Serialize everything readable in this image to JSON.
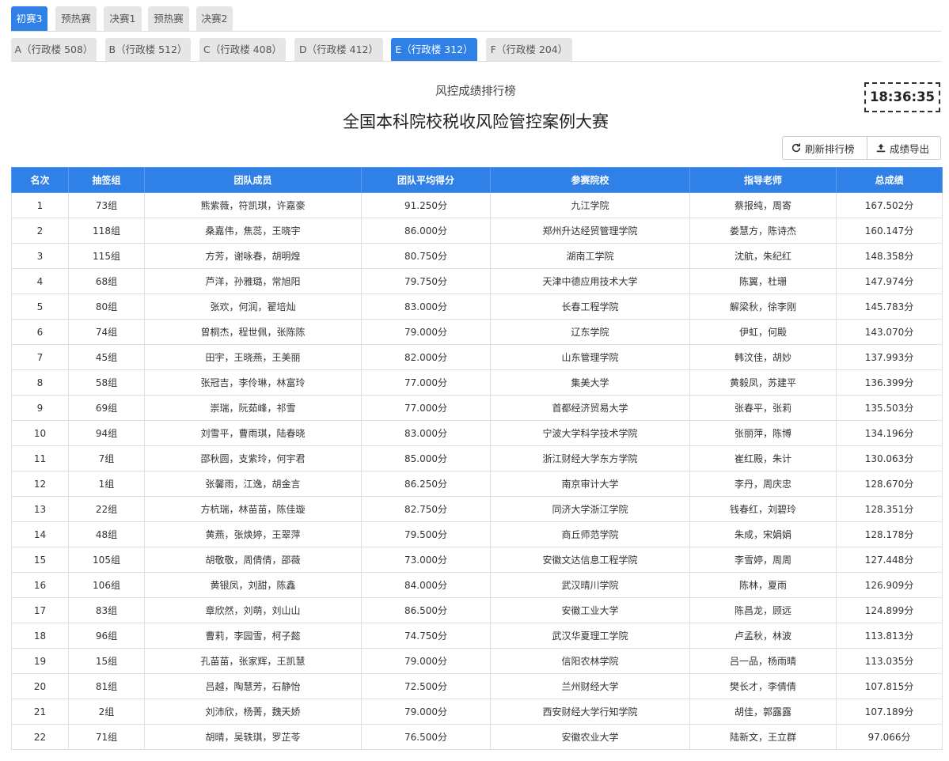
{
  "round_tabs": [
    "初赛3",
    "预热赛",
    "决赛1",
    "预热赛",
    "决赛2"
  ],
  "room_tabs": [
    "A（行政楼 508）",
    "B（行政楼 512）",
    "C（行政楼 408）",
    "D（行政楼 412）",
    "E（行政楼 312）",
    "F（行政楼 204）"
  ],
  "active_round": "初赛3",
  "active_room": "E（行政楼 312）",
  "subtitle": "风控成绩排行榜",
  "title": "全国本科院校税收风险管控案例大赛",
  "clock": "18:36:35",
  "buttons": {
    "refresh": "刷新排行榜",
    "export": "成绩导出"
  },
  "accent_color": "#2f80e7",
  "table": {
    "headers": [
      "名次",
      "抽签组",
      "团队成员",
      "团队平均得分",
      "参赛院校",
      "指导老师",
      "总成绩"
    ],
    "rows": [
      [
        "1",
        "73组",
        "熊紫薇，符凯琪，许嘉豪",
        "91.250分",
        "九江学院",
        "蔡报纯，周寄",
        "167.502分"
      ],
      [
        "2",
        "118组",
        "桑嘉伟，焦蕊，王晓宇",
        "86.000分",
        "郑州升达经贸管理学院",
        "娄慧方，陈诗杰",
        "160.147分"
      ],
      [
        "3",
        "115组",
        "方芳，谢咏春，胡明煌",
        "80.750分",
        "湖南工学院",
        "沈航，朱纪红",
        "148.358分"
      ],
      [
        "4",
        "68组",
        "芦洋，孙雅璐，常旭阳",
        "79.750分",
        "天津中德应用技术大学",
        "陈翼，杜珊",
        "147.974分"
      ],
      [
        "5",
        "80组",
        "张欢，何润，翟培灿",
        "83.000分",
        "长春工程学院",
        "解梁秋，徐李刚",
        "145.783分"
      ],
      [
        "6",
        "74组",
        "曾桐杰，程世佩，张陈陈",
        "79.000分",
        "辽东学院",
        "伊虹，何殿",
        "143.070分"
      ],
      [
        "7",
        "45组",
        "田宇，王晓燕，王美丽",
        "82.000分",
        "山东管理学院",
        "韩汶佳，胡妙",
        "137.993分"
      ],
      [
        "8",
        "58组",
        "张冠吉，李伶琳，林富玲",
        "77.000分",
        "集美大学",
        "黄毅凤，苏建平",
        "136.399分"
      ],
      [
        "9",
        "69组",
        "崇瑞，阮茹峰，祁雪",
        "77.000分",
        "首都经济贸易大学",
        "张春平，张莉",
        "135.503分"
      ],
      [
        "10",
        "94组",
        "刘雪平，曹雨琪，陆春晓",
        "83.000分",
        "宁波大学科学技术学院",
        "张丽萍，陈博",
        "134.196分"
      ],
      [
        "11",
        "7组",
        "邵秋圆，支紫玲，何宇君",
        "85.000分",
        "浙江财经大学东方学院",
        "崔红殿，朱计",
        "130.063分"
      ],
      [
        "12",
        "1组",
        "张馨雨，江逸，胡金言",
        "86.250分",
        "南京审计大学",
        "李丹，周庆忠",
        "128.670分"
      ],
      [
        "13",
        "22组",
        "方杭瑞，林苗苗，陈佳璇",
        "82.750分",
        "同济大学浙江学院",
        "钱春红，刘碧玲",
        "128.351分"
      ],
      [
        "14",
        "48组",
        "黄燕，张焕婷，王翠萍",
        "79.500分",
        "商丘师范学院",
        "朱成，宋娟娟",
        "128.178分"
      ],
      [
        "15",
        "105组",
        "胡敬敬，周倩倩，邵薇",
        "73.000分",
        "安徽文达信息工程学院",
        "李雪婷，周周",
        "127.448分"
      ],
      [
        "16",
        "106组",
        "黄银凤，刘甜，陈鑫",
        "84.000分",
        "武汉晴川学院",
        "陈林，夏雨",
        "126.909分"
      ],
      [
        "17",
        "83组",
        "章欣然，刘萌，刘山山",
        "86.500分",
        "安徽工业大学",
        "陈昌龙，顾远",
        "124.899分"
      ],
      [
        "18",
        "96组",
        "曹莉，李园雪，柯子懿",
        "74.750分",
        "武汉华夏理工学院",
        "卢孟秋，林波",
        "113.813分"
      ],
      [
        "19",
        "15组",
        "孔苗苗，张家辉，王凯慧",
        "79.000分",
        "信阳农林学院",
        "吕一品，杨雨晴",
        "113.035分"
      ],
      [
        "20",
        "81组",
        "吕越，陶慧芳，石静怡",
        "72.500分",
        "兰州财经大学",
        "樊长才，李倩倩",
        "107.815分"
      ],
      [
        "21",
        "2组",
        "刘沛欣，杨菁，魏天娇",
        "79.000分",
        "西安财经大学行知学院",
        "胡佳，郭露露",
        "107.189分"
      ],
      [
        "22",
        "71组",
        "胡晴，吴轶琪，罗芷苓",
        "76.500分",
        "安徽农业大学",
        "陆新文，王立群",
        "97.066分"
      ]
    ]
  }
}
